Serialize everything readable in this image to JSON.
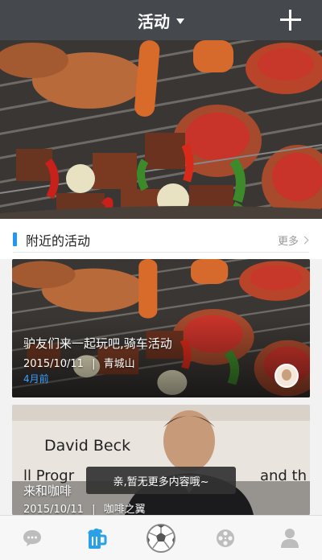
{
  "header": {
    "title": "活动"
  },
  "section": {
    "title": "附近的活动",
    "more_label": "更多"
  },
  "events": [
    {
      "title": "驴友们来一起玩吧,骑车活动",
      "date": "2015/10/11",
      "separator": "|",
      "location": "青城山",
      "extra": "4月前"
    },
    {
      "title": "来和咖啡",
      "date": "2015/10/11",
      "separator": "|",
      "location": "咖啡之翼"
    }
  ],
  "card2_bg_texts": [
    "David Beck",
    "ll Progr",
    "and th"
  ],
  "toast": {
    "text": "亲,暂无更多内容哦~"
  },
  "tabs": [
    {
      "icon": "chat-icon",
      "active": false
    },
    {
      "icon": "beer-icon",
      "active": true
    },
    {
      "icon": "soccer-ball-icon",
      "active": false
    },
    {
      "icon": "film-reel-icon",
      "active": false
    },
    {
      "icon": "person-icon",
      "active": false
    }
  ],
  "colors": {
    "topbar": "#45484d",
    "accent": "#2196f3",
    "toast": "#323232"
  }
}
